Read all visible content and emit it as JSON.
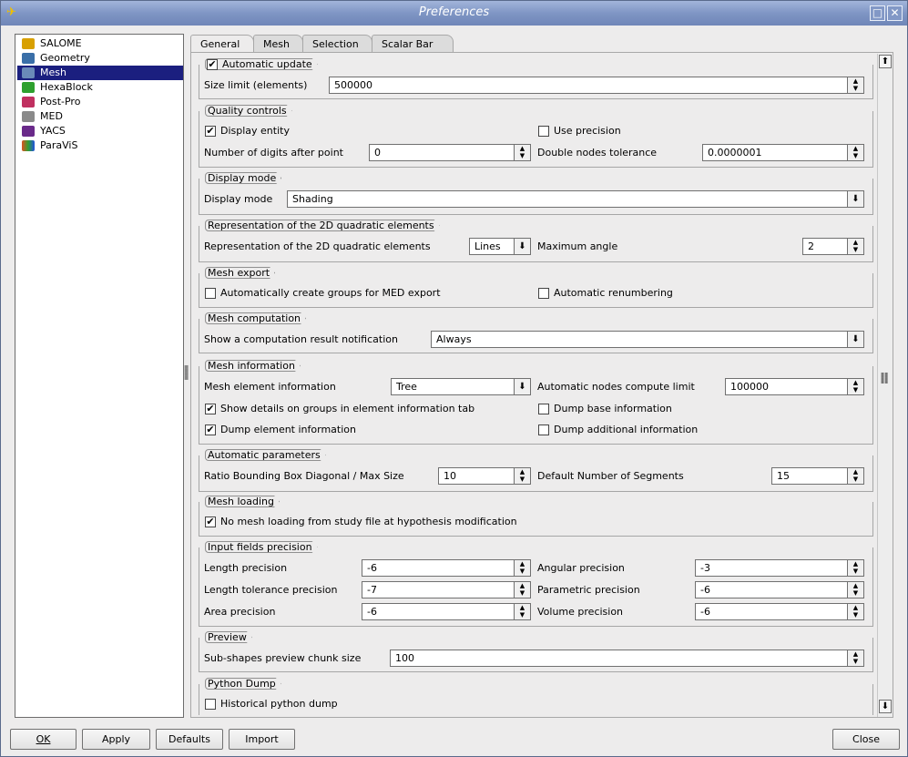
{
  "window": {
    "title": "Preferences",
    "restore_label": "□",
    "close_label": "✕"
  },
  "modules": [
    {
      "label": "SALOME",
      "icon": "salome-icon",
      "color": "#d8a000"
    },
    {
      "label": "Geometry",
      "icon": "geometry-icon",
      "color": "#3a6fa8"
    },
    {
      "label": "Mesh",
      "icon": "mesh-icon",
      "color": "#6a8ab8",
      "selected": true
    },
    {
      "label": "HexaBlock",
      "icon": "hexablock-icon",
      "color": "#2ea02e"
    },
    {
      "label": "Post-Pro",
      "icon": "post-pro-icon",
      "color": "#c03060"
    },
    {
      "label": "MED",
      "icon": "med-icon",
      "color": "#8a8a8a"
    },
    {
      "label": "YACS",
      "icon": "yacs-icon",
      "color": "#6a2a8a"
    },
    {
      "label": "ParaViS",
      "icon": "paravis-icon",
      "color": "#e05020"
    }
  ],
  "tabs": [
    "General",
    "Mesh",
    "Selection",
    "Scalar Bar"
  ],
  "groups": {
    "auto_update": {
      "title": "Automatic update",
      "checked": true,
      "size_limit_label": "Size limit (elements)",
      "size_limit_value": "500000"
    },
    "quality": {
      "title": "Quality controls",
      "display_entity": "Display entity",
      "use_precision": "Use precision",
      "digits_label": "Number of digits after point",
      "digits_value": "0",
      "tolerance_label": "Double nodes tolerance",
      "tolerance_value": "0.0000001"
    },
    "display_mode": {
      "title": "Display mode",
      "label": "Display mode",
      "value": "Shading"
    },
    "quadratic": {
      "title": "Representation of the 2D quadratic elements",
      "label": "Representation of the 2D quadratic elements",
      "value": "Lines",
      "max_angle_label": "Maximum angle",
      "max_angle_value": "2"
    },
    "export": {
      "title": "Mesh export",
      "auto_groups": "Automatically create groups for MED export",
      "auto_renum": "Automatic renumbering"
    },
    "computation": {
      "title": "Mesh computation",
      "label": "Show a computation result notification",
      "value": "Always"
    },
    "information": {
      "title": "Mesh information",
      "elem_info_label": "Mesh element information",
      "elem_info_value": "Tree",
      "nodes_limit_label": "Automatic nodes compute limit",
      "nodes_limit_value": "100000",
      "show_details": "Show details on groups in element information tab",
      "dump_base": "Dump base information",
      "dump_element": "Dump element information",
      "dump_additional": "Dump additional information"
    },
    "auto_params": {
      "title": "Automatic parameters",
      "ratio_label": "Ratio Bounding Box Diagonal / Max Size",
      "ratio_value": "10",
      "segments_label": "Default Number of Segments",
      "segments_value": "15"
    },
    "loading": {
      "title": "Mesh loading",
      "label": "No mesh loading from study file at hypothesis modification"
    },
    "precision": {
      "title": "Input fields precision",
      "length_label": "Length precision",
      "length_value": "-6",
      "angular_label": "Angular precision",
      "angular_value": "-3",
      "len_tol_label": "Length tolerance precision",
      "len_tol_value": "-7",
      "parametric_label": "Parametric precision",
      "parametric_value": "-6",
      "area_label": "Area precision",
      "area_value": "-6",
      "volume_label": "Volume precision",
      "volume_value": "-6"
    },
    "preview": {
      "title": "Preview",
      "label": "Sub-shapes preview chunk size",
      "value": "100"
    },
    "python_dump": {
      "title": "Python Dump",
      "label": "Historical python dump"
    }
  },
  "buttons": {
    "ok": "OK",
    "apply": "Apply",
    "defaults": "Defaults",
    "import": "Import",
    "close": "Close"
  }
}
